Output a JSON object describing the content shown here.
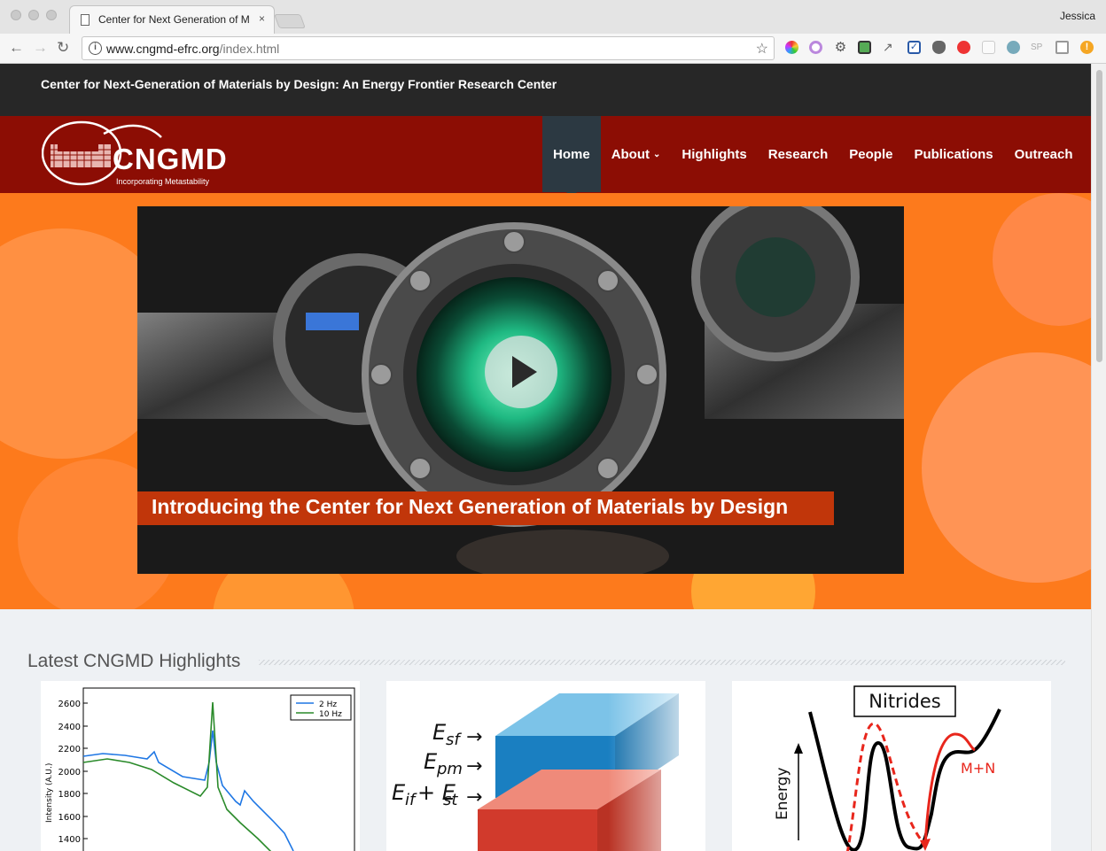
{
  "browser": {
    "tab_title": "Center for Next Generation of Materials by Design",
    "tab_close": "×",
    "profile": "Jessica",
    "url_host": "www.cngmd-efrc.org",
    "url_path": "/index.html",
    "info": "i",
    "star": "☆",
    "back": "←",
    "forward": "→",
    "reload": "↻"
  },
  "site": {
    "topbar_text": "Center for Next-Generation of Materials by Design: An Energy Frontier Research Center",
    "logo_word": "CNGMD",
    "logo_tagline": "Incorporating Metastability",
    "nav": {
      "home": "Home",
      "about": "About",
      "about_caret": "⌄",
      "highlights": "Highlights",
      "research": "Research",
      "people": "People",
      "publications": "Publications",
      "outreach": "Outreach"
    },
    "video_caption": "Introducing the Center for Next Generation of Materials by Design",
    "section_title": "Latest CNGMD Highlights",
    "colors": {
      "topbar": "#272727",
      "navbar": "#8c0d04",
      "nav_active": "#2c3942",
      "hero": "#fd7a1c",
      "caption": "#c1360a"
    }
  },
  "card1": {
    "ylabel": "Intensity (A.U.)",
    "yticks": [
      "2600",
      "2400",
      "2200",
      "2000",
      "1800",
      "1600",
      "1400"
    ],
    "legend": [
      "2 Hz",
      "10 Hz"
    ],
    "colors": [
      "#1f77e4",
      "#2a8a2a"
    ]
  },
  "card2": {
    "labels": [
      "E",
      "sf",
      "E",
      "pm",
      "E",
      "if",
      "+ E",
      "st"
    ],
    "arrow": "→",
    "colors": [
      "#1a7fc1",
      "#d13a2c"
    ]
  },
  "card3": {
    "title": "Nitrides",
    "ylabel": "Energy",
    "annotation": "M+N",
    "accent": "#e8261c"
  }
}
